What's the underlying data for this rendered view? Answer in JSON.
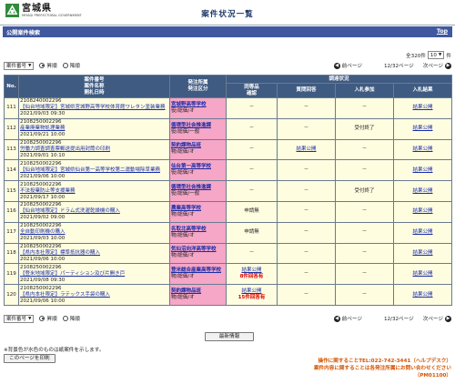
{
  "header": {
    "logo_text": "宮城県",
    "logo_sub": "MIYAGI PREFECTURAL GOVERNMENT",
    "title": "案件状況一覧"
  },
  "bar": {
    "label": "公開案件検索",
    "top_link": "Top"
  },
  "count": {
    "total": "全320件",
    "per_page": "10",
    "unit": "件"
  },
  "controls": {
    "sort_field": "案件番号",
    "sort_asc": "昇順",
    "sort_desc": "降順",
    "prev": "前ページ",
    "page": "12/32ページ",
    "next": "次ページ"
  },
  "table": {
    "headers": {
      "no": "No.",
      "item": [
        "案件番号",
        "案件名称",
        "開札日時"
      ],
      "office": [
        "発注所属",
        "発注区分"
      ],
      "status_group": "調達状況",
      "same_item": [
        "同等品",
        "確認"
      ],
      "question": "質問回答",
      "entry": "入札参加",
      "result": "入札結果"
    },
    "rows": [
      {
        "no": "111",
        "id": "2108240002296",
        "name": "【仙台地域限定】宮城県宮城野高等学校体育館ワレタン塗装業務",
        "date": "2021/09/03 09:30",
        "office": "宮城野高等学校",
        "category": "役/総価/オ",
        "same_item": "－",
        "question": "－",
        "entry": "－",
        "result": "結果公開"
      },
      {
        "no": "112",
        "id": "2108250002296",
        "name": "産業廃棄物処理業務",
        "date": "2021/09/21 10:00",
        "office": "循環型社会推進課",
        "category": "役/総価/一般",
        "same_item": "－",
        "question": "－",
        "entry": "受付終了",
        "result": "結果公開"
      },
      {
        "no": "113",
        "id": "2108250002296",
        "name": "労働力調査調査票郵送提出用封筒の印刷",
        "date": "2021/09/01 10:10",
        "office": "契約課物品班",
        "category": "物/総価/オ",
        "same_item": "－",
        "question": "結果公開",
        "entry": "－",
        "result": "結果公開"
      },
      {
        "no": "114",
        "id": "2108250002296",
        "name": "【仙台地域限定】宮城県仙台第一高等学校第二運動場除草業務",
        "date": "2021/09/06 10:00",
        "office": "仙台第一高等学校",
        "category": "役/総価/オ",
        "same_item": "－",
        "question": "－",
        "entry": "－",
        "result": "結果公開"
      },
      {
        "no": "115",
        "id": "2108250002296",
        "name": "不法投棄防止等支援業務",
        "date": "2021/09/17 10:00",
        "office": "循環型社会推進課",
        "category": "役/総価/一般",
        "same_item": "－",
        "question": "－",
        "entry": "受付終了",
        "result": "結果公開"
      },
      {
        "no": "116",
        "id": "2108250002296",
        "name": "【仙台地域限定】ドラム式洗濯乾燥機の購入",
        "date": "2021/09/02 09:00",
        "office": "農業高等学校",
        "category": "物/総価/オ",
        "same_item": "申請無",
        "question": "－",
        "entry": "－",
        "result": "結果公開"
      },
      {
        "no": "117",
        "id": "2108250002296",
        "name": "全自動印刷機の購入",
        "date": "2021/09/03 10:00",
        "office": "名取北高等学校",
        "category": "物/総価/オ",
        "same_item": "申請無",
        "question": "－",
        "entry": "－",
        "result": "結果公開"
      },
      {
        "no": "118",
        "id": "2108250002296",
        "name": "【県内本社限定】標準抵抗器の購入",
        "date": "2021/09/06 10:00",
        "office": "気仙沼向洋高等学校",
        "category": "物/総価/オ",
        "same_item": "－",
        "question": "－",
        "entry": "－",
        "result": "結果公開"
      },
      {
        "no": "119",
        "id": "2108250002296",
        "name": "【登米地域限定】パーティション及び片開き戸",
        "date": "2021/09/08 09:30",
        "office": "登米総合産業高等学校",
        "category": "物/総価/オ",
        "same_item": "結果公開",
        "same_item_note": "8件回答有",
        "question": "－",
        "entry": "－",
        "result": "結果公開"
      },
      {
        "no": "120",
        "id": "2108250002296",
        "name": "【県内本社限定】ラテックス手袋の購入",
        "date": "2021/09/06 10:00",
        "office": "契約課物品班",
        "category": "物/総価/オ",
        "same_item": "結果公開",
        "same_item_note": "15件回答有",
        "question": "－",
        "entry": "－",
        "result": "結果公開"
      }
    ]
  },
  "footer": {
    "latest_button": "最新情報",
    "note": "※背景色が水色のものは紙案件を示します。",
    "print_button": "このページを印刷",
    "contact_line1": "操作に関することTEL:022-742-3441（ヘルプデスク）",
    "contact_line2": "案件内容に関することは各発注所属にお問い合わせください",
    "code": "（PM01100）"
  }
}
